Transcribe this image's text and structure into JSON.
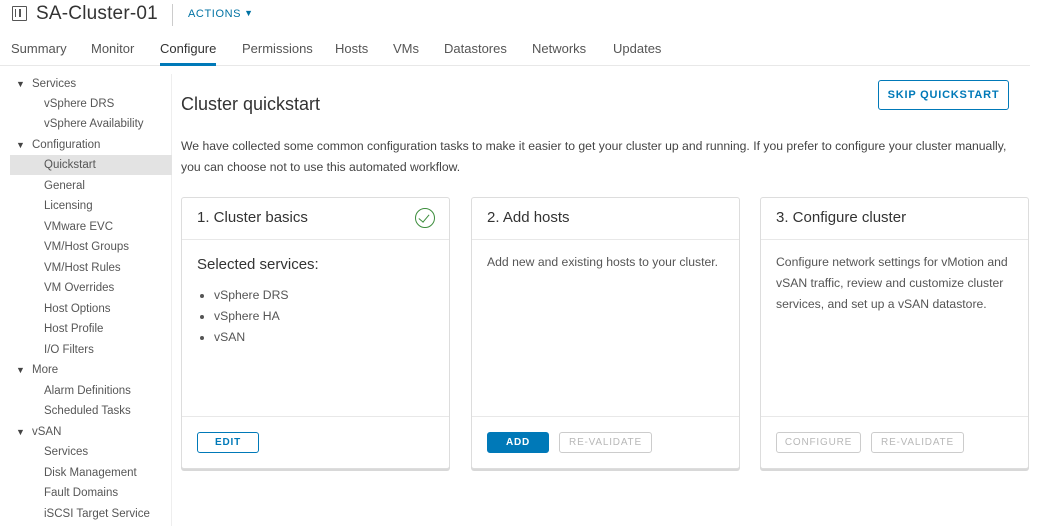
{
  "header": {
    "title": "SA-Cluster-01",
    "actions_label": "ACTIONS",
    "icon": "cluster-icon"
  },
  "tabs": [
    {
      "label": "Summary"
    },
    {
      "label": "Monitor"
    },
    {
      "label": "Configure",
      "active": true
    },
    {
      "label": "Permissions"
    },
    {
      "label": "Hosts"
    },
    {
      "label": "VMs"
    },
    {
      "label": "Datastores"
    },
    {
      "label": "Networks"
    },
    {
      "label": "Updates"
    }
  ],
  "sidebar": {
    "items": [
      {
        "label": "Services",
        "type": "group"
      },
      {
        "label": "vSphere DRS",
        "type": "child"
      },
      {
        "label": "vSphere Availability",
        "type": "child"
      },
      {
        "label": "Configuration",
        "type": "group"
      },
      {
        "label": "Quickstart",
        "type": "child",
        "selected": true
      },
      {
        "label": "General",
        "type": "child"
      },
      {
        "label": "Licensing",
        "type": "child"
      },
      {
        "label": "VMware EVC",
        "type": "child"
      },
      {
        "label": "VM/Host Groups",
        "type": "child"
      },
      {
        "label": "VM/Host Rules",
        "type": "child"
      },
      {
        "label": "VM Overrides",
        "type": "child"
      },
      {
        "label": "Host Options",
        "type": "child"
      },
      {
        "label": "Host Profile",
        "type": "child"
      },
      {
        "label": "I/O Filters",
        "type": "child"
      },
      {
        "label": "More",
        "type": "group"
      },
      {
        "label": "Alarm Definitions",
        "type": "child"
      },
      {
        "label": "Scheduled Tasks",
        "type": "child"
      },
      {
        "label": "vSAN",
        "type": "group"
      },
      {
        "label": "Services",
        "type": "child"
      },
      {
        "label": "Disk Management",
        "type": "child"
      },
      {
        "label": "Fault Domains",
        "type": "child"
      },
      {
        "label": "iSCSI Target Service",
        "type": "child"
      }
    ]
  },
  "main": {
    "title": "Cluster quickstart",
    "skip_label": "SKIP QUICKSTART",
    "intro": "We have collected some common configuration tasks to make it easier to get your cluster up and running. If you prefer to configure your cluster manually, you can choose not to use this automated workflow."
  },
  "cards": [
    {
      "title": "1. Cluster basics",
      "completed": true,
      "heading": "Selected services:",
      "services": [
        "vSphere DRS",
        "vSphere HA",
        "vSAN"
      ],
      "buttons": [
        {
          "label": "EDIT",
          "style": "outline"
        }
      ]
    },
    {
      "title": "2. Add hosts",
      "description": "Add new and existing hosts to your cluster.",
      "buttons": [
        {
          "label": "ADD",
          "style": "primary"
        },
        {
          "label": "RE-VALIDATE",
          "style": "disabled"
        }
      ]
    },
    {
      "title": "3. Configure cluster",
      "description": "Configure network settings for vMotion and vSAN traffic, review and customize cluster services, and set up a vSAN datastore.",
      "buttons": [
        {
          "label": "CONFIGURE",
          "style": "disabled"
        },
        {
          "label": "RE-VALIDATE",
          "style": "disabled"
        }
      ]
    }
  ],
  "colors": {
    "accent": "#0079b8",
    "success": "#3c8d3c",
    "selected_bg": "#e3e3e3"
  }
}
